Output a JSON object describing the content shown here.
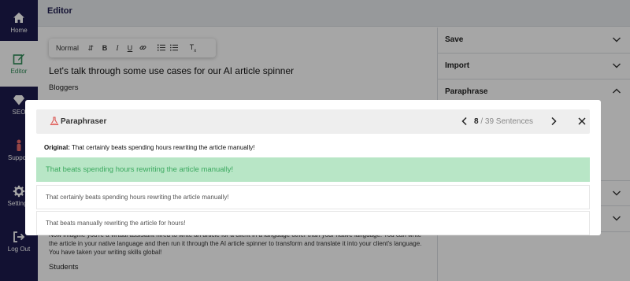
{
  "sidebar": {
    "items": [
      {
        "label": "Home",
        "icon": "home-icon"
      },
      {
        "label": "Editor",
        "icon": "edit-icon"
      },
      {
        "label": "SEO",
        "icon": "diamond-icon"
      },
      {
        "label": "Support",
        "icon": "person-icon"
      },
      {
        "label": "Settings",
        "icon": "gear-icon"
      },
      {
        "label": "Log Out",
        "icon": "logout-icon"
      }
    ]
  },
  "topbar": {
    "title": "Editor"
  },
  "toolbar": {
    "format_value": "Normal"
  },
  "editor": {
    "headline": "Let's talk through some use cases for our AI article spinner",
    "sub1": "Bloggers",
    "paragraph": "Now imagine you're a virtual assistant hired to write an article for a client in a language other than your native language. You can write the article in your native language and then run it through the AI article spinner to transform and translate it into your client's language. You have taken your writing skills global!",
    "sub2": "Students"
  },
  "right_panel": {
    "sections": [
      "Save",
      "Import",
      "Paraphrase"
    ]
  },
  "modal": {
    "title": "Paraphraser",
    "current": "8",
    "total_text": "/ 39 Sentences",
    "original_label": "Original:",
    "original_text": "That certainly beats spending hours rewriting the article manually!",
    "options": [
      "That beats spending hours rewriting the article manually!",
      "That certainly beats spending hours rewriting the article manually!",
      "That beats manually rewriting the article for hours!"
    ],
    "selected_index": 0
  },
  "colors": {
    "sidebar_bg": "#1c1b4d",
    "accent_green": "#2e8b57",
    "selected_bg": "#b8e6c6",
    "selected_text": "#3aa85e"
  }
}
